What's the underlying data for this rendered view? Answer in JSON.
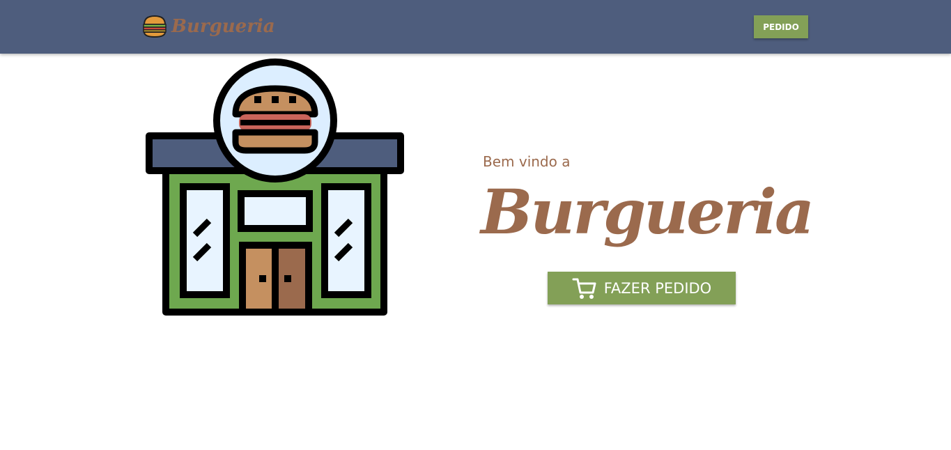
{
  "navbar": {
    "brand_name": "Burgueria",
    "logo_icon": "burger-icon",
    "order_button_label": "PEDIDO"
  },
  "hero": {
    "illustration_icon": "burger-shop-icon",
    "welcome_text": "Bem vindo a",
    "title": "Burgueria",
    "cta_label": "FAZER PEDIDO",
    "cta_icon": "cart-icon"
  },
  "colors": {
    "navbar_bg": "#4e5d7d",
    "accent_green": "#83a057",
    "brand_brown": "#9b6a4d"
  }
}
